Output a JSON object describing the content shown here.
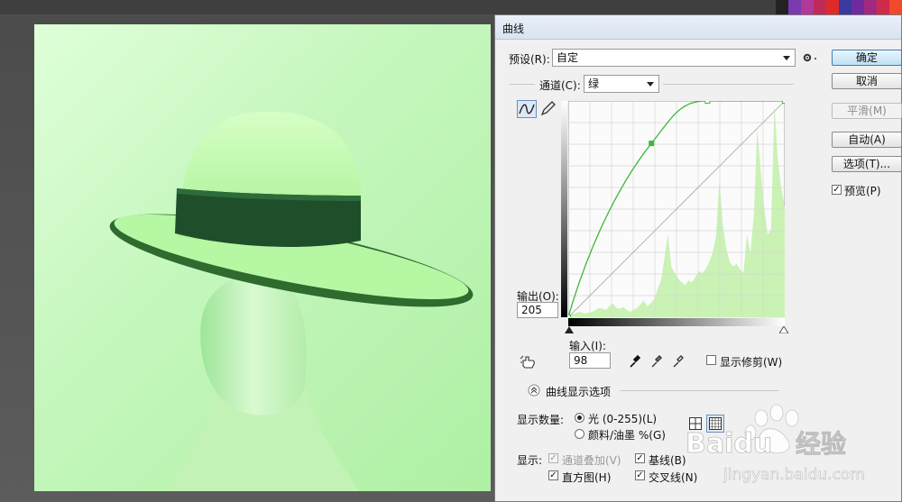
{
  "dialog": {
    "title": "曲线",
    "preset_label": "预设(R):",
    "preset_value": "自定",
    "channel_label": "通道(C):",
    "channel_value": "绿",
    "output_label": "输出(O):",
    "output_value": "205",
    "input_label": "输入(I):",
    "input_value": "98",
    "show_clipping_label": "显示修剪(W)",
    "show_clipping_checked": false,
    "options_header": "曲线显示选项",
    "show_amount_label": "显示数量:",
    "light_label": "光 (0-255)(L)",
    "pigment_label": "颜料/油墨 %(G)",
    "show_label": "显示:",
    "channel_overlay_label": "通道叠加(V)",
    "baseline_label": "基线(B)",
    "histogram_label": "直方图(H)",
    "intersection_label": "交叉线(N)"
  },
  "buttons": {
    "ok": "确定",
    "cancel": "取消",
    "smooth": "平滑(M)",
    "auto": "自动(A)",
    "options": "选项(T)...",
    "preview": "预览(P)"
  },
  "watermark": {
    "brand": "Baidu",
    "cn": "经验",
    "url": "jingyan.baidu.com"
  },
  "colors": {
    "curve": "#3db83d",
    "histogram": "#c9f2b4",
    "image_tint": "#b4f3a8",
    "accent": "#3c7fb1"
  },
  "curve_points": [
    [
      0,
      0
    ],
    [
      98,
      205
    ],
    [
      164,
      255
    ],
    [
      255,
      255
    ]
  ],
  "icons": [
    "curve-tool-icon",
    "pencil-icon",
    "gear-icon",
    "hand-adjust-icon",
    "eyedropper-black-icon",
    "eyedropper-gray-icon",
    "eyedropper-white-icon",
    "collapse-icon",
    "simple-grid-icon",
    "detailed-grid-icon"
  ]
}
